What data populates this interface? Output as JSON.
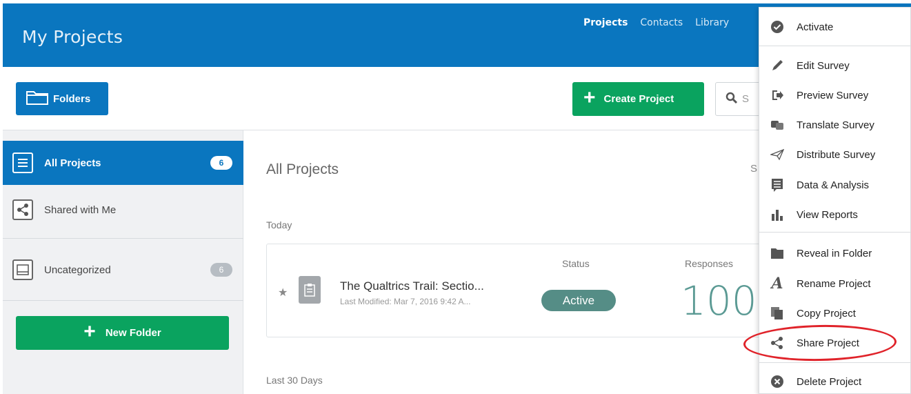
{
  "header": {
    "app_title": "My Projects",
    "nav": [
      {
        "label": "Projects",
        "active": true
      },
      {
        "label": "Contacts",
        "active": false
      },
      {
        "label": "Library",
        "active": false
      }
    ]
  },
  "toolbar": {
    "folders_label": "Folders",
    "create_label": "Create Project",
    "search_placeholder": "S"
  },
  "sidebar": {
    "items": [
      {
        "label": "All Projects",
        "count": "6",
        "icon": "list-icon",
        "active": true
      },
      {
        "label": "Shared with Me",
        "icon": "share-icon",
        "active": false
      },
      {
        "label": "Uncategorized",
        "count": "6",
        "icon": "inbox-icon",
        "active": false
      }
    ],
    "new_folder_label": "New Folder"
  },
  "main": {
    "title": "All Projects",
    "truncated_right": "S",
    "groups": [
      "Today",
      "Last 30 Days"
    ],
    "project": {
      "name": "The Qualtrics Trail: Sectio...",
      "modified": "Last Modified: Mar 7, 2016 9:42 A...",
      "status_header": "Status",
      "status": "Active",
      "responses_header": "Responses",
      "responses": "100"
    }
  },
  "menu": {
    "items": [
      {
        "label": "Activate",
        "icon": "check-circle-icon"
      },
      {
        "label": "Edit Survey",
        "icon": "pencil-icon"
      },
      {
        "label": "Preview Survey",
        "icon": "preview-icon"
      },
      {
        "label": "Translate Survey",
        "icon": "translate-icon"
      },
      {
        "label": "Distribute Survey",
        "icon": "paper-plane-icon"
      },
      {
        "label": "Data & Analysis",
        "icon": "data-icon"
      },
      {
        "label": "View Reports",
        "icon": "bar-chart-icon"
      },
      {
        "label": "Reveal in Folder",
        "icon": "folder-icon"
      },
      {
        "label": "Rename Project",
        "icon": "rename-icon"
      },
      {
        "label": "Copy Project",
        "icon": "copy-icon"
      },
      {
        "label": "Share Project",
        "icon": "share-icon"
      },
      {
        "label": "Delete Project",
        "icon": "delete-icon"
      }
    ]
  },
  "colors": {
    "brand_blue": "#0a76bf",
    "action_green": "#0aa35f",
    "status_teal": "#558d86",
    "highlight_red": "#e0232a"
  }
}
